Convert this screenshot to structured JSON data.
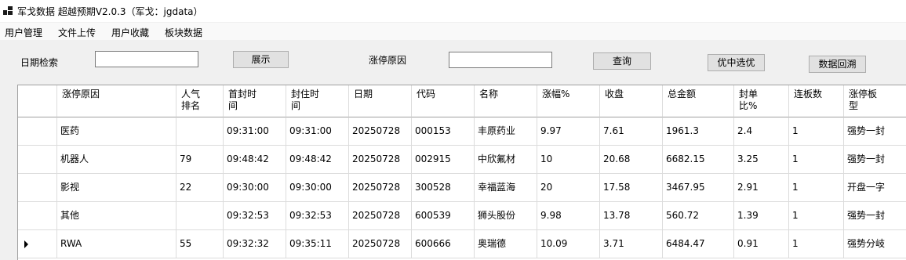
{
  "window": {
    "title": "军戈数据 超越预期V2.0.3（军戈：jgdata）",
    "icon": "app-grid-icon"
  },
  "menu": [
    "用户管理",
    "文件上传",
    "用户收藏",
    "板块数据"
  ],
  "toolbar": {
    "date_label": "日期检索",
    "date_value": "",
    "show_button": "展示",
    "reason_label": "涨停原因",
    "reason_value": "",
    "query_button": "查询",
    "pick_button": "优中选优",
    "backtest_button": "数据回溯"
  },
  "table": {
    "columns": [
      "涨停原因",
      "人气\n排名",
      "首封时\n间",
      "封住时\n间",
      "日期",
      "代码",
      "名称",
      "涨幅%",
      "收盘",
      "总金额",
      "封单\n比%",
      "连板数",
      "涨停板\n型"
    ],
    "rows": [
      [
        "医药",
        "",
        "09:31:00",
        "09:31:00",
        "20250728",
        "000153",
        "丰原药业",
        "9.97",
        "7.61",
        "1961.3",
        "2.4",
        "1",
        "强势一封"
      ],
      [
        "机器人",
        "79",
        "09:48:42",
        "09:48:42",
        "20250728",
        "002915",
        "中欣氟材",
        "10",
        "20.68",
        "6682.15",
        "3.25",
        "1",
        "强势一封"
      ],
      [
        "影视",
        "22",
        "09:30:00",
        "09:30:00",
        "20250728",
        "300528",
        "幸福蓝海",
        "20",
        "17.58",
        "3467.95",
        "2.91",
        "1",
        "开盘一字"
      ],
      [
        "其他",
        "",
        "09:32:53",
        "09:32:53",
        "20250728",
        "600539",
        "狮头股份",
        "9.98",
        "13.78",
        "560.72",
        "1.39",
        "1",
        "强势一封"
      ],
      [
        "RWA",
        "55",
        "09:32:32",
        "09:35:11",
        "20250728",
        "600666",
        "奥瑞德",
        "10.09",
        "3.71",
        "6484.47",
        "0.91",
        "1",
        "强势分岐"
      ]
    ],
    "current_row": 4
  }
}
